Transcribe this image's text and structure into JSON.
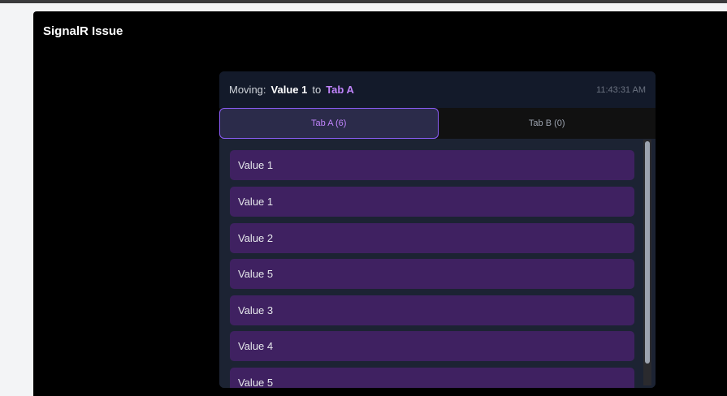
{
  "app": {
    "title": "SignalR Issue"
  },
  "status": {
    "moving_label": "Moving:",
    "item_name": "Value 1",
    "connector": "to",
    "target_tab": "Tab A",
    "timestamp": "11:43:31 AM"
  },
  "tabs": [
    {
      "label": "Tab A (6)",
      "active": true
    },
    {
      "label": "Tab B (0)",
      "active": false
    }
  ],
  "list": {
    "items": [
      "Value 1",
      "Value 1",
      "Value 2",
      "Value 5",
      "Value 3",
      "Value 4",
      "Value 5"
    ]
  },
  "colors": {
    "accent": "#c084fc",
    "item_bg": "#3f2161",
    "panel_bg": "#000000"
  }
}
